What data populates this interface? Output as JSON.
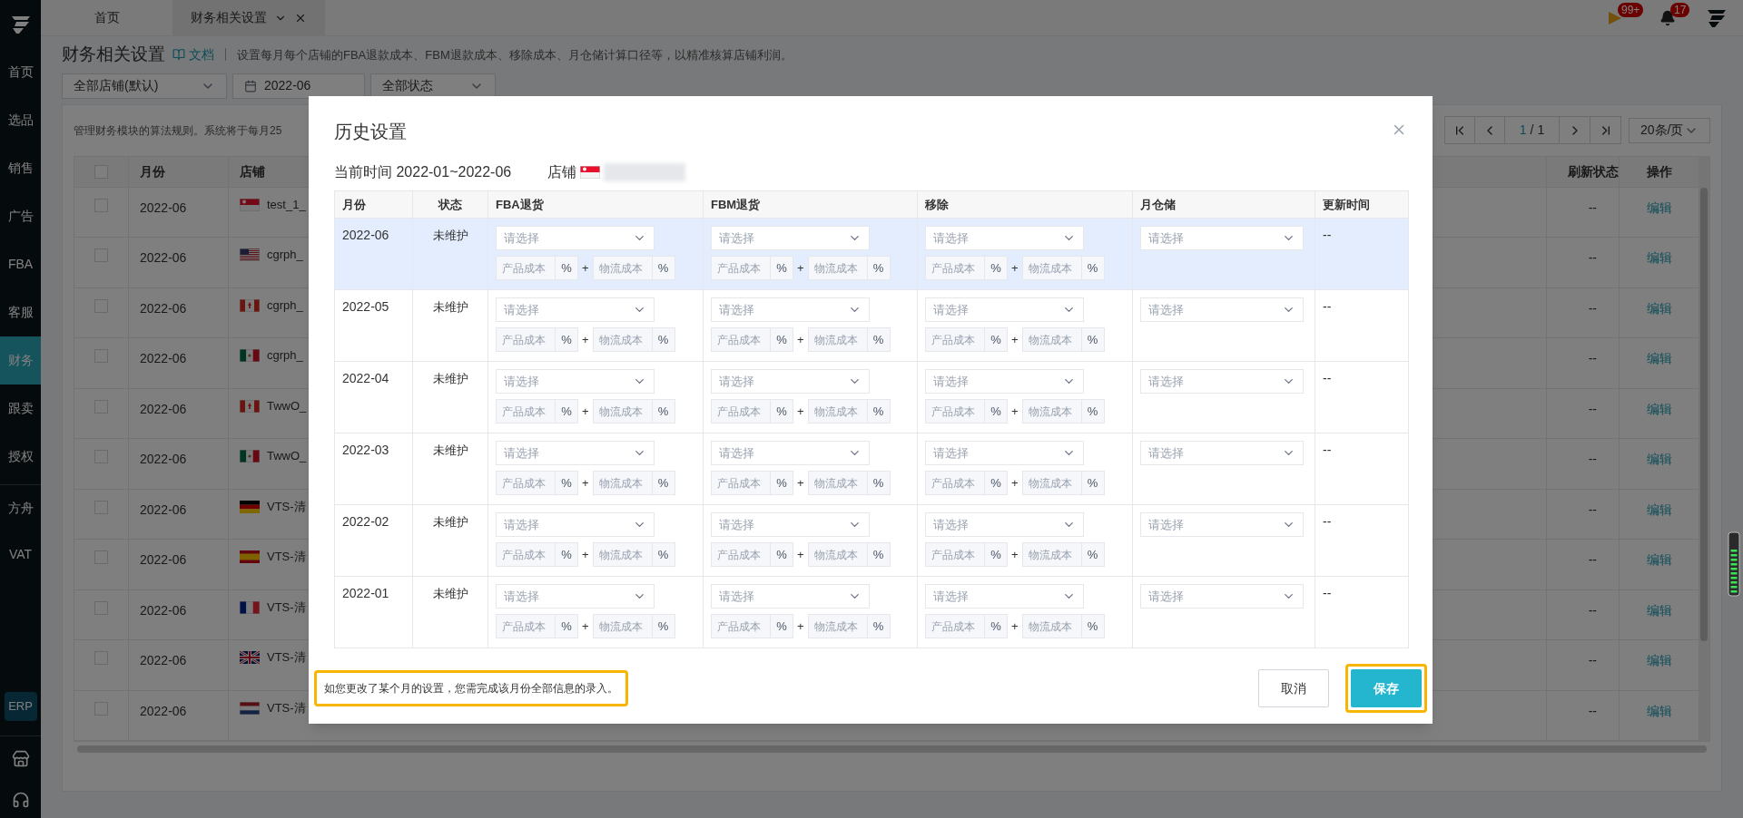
{
  "sidebar": {
    "items": [
      {
        "label": "首页",
        "selected": false
      },
      {
        "label": "选品",
        "selected": false
      },
      {
        "label": "销售",
        "selected": false
      },
      {
        "label": "广告",
        "selected": false
      },
      {
        "label": "FBA",
        "selected": false
      },
      {
        "label": "客服",
        "selected": false
      },
      {
        "label": "财务",
        "selected": true
      },
      {
        "label": "跟卖",
        "selected": false
      },
      {
        "label": "授权",
        "selected": false
      }
    ],
    "extra_items": [
      "方舟",
      "VAT"
    ],
    "erp": "ERP"
  },
  "tabs": [
    {
      "label": "首页",
      "selected": false,
      "closable": false
    },
    {
      "label": "财务相关设置",
      "selected": true,
      "closable": true
    }
  ],
  "header": {
    "flag_badge": "99+",
    "bell_badge": "17"
  },
  "page": {
    "title": "财务相关设置",
    "doc_link": "文档",
    "description": "设置每月每个店铺的FBA退款成本、FBM退款成本、移除成本、月仓储计算口径等，以精准核算店铺利润。"
  },
  "filters": {
    "store": "全部店铺(默认)",
    "date": "2022-06",
    "status": "全部状态"
  },
  "info": "管理财务模块的算法规则。系统将于每月25",
  "pagination": {
    "page": "1",
    "total": "/ 1",
    "page_size": "20条/页"
  },
  "table": {
    "columns": [
      "月份",
      "店铺",
      "刷新状态",
      "操作"
    ],
    "all_checked": false,
    "rows": [
      {
        "checked": false,
        "month": "2022-06",
        "flag": {
          "kind": "sg"
        },
        "store": "test_1_",
        "refresh": "--",
        "action": "编辑"
      },
      {
        "checked": false,
        "month": "2022-06",
        "flag": {
          "kind": "us"
        },
        "store": "cgrph_",
        "refresh": "--",
        "action": "编辑"
      },
      {
        "checked": false,
        "month": "2022-06",
        "flag": {
          "kind": "ca"
        },
        "store": "cgrph_",
        "refresh": "--",
        "action": "编辑"
      },
      {
        "checked": false,
        "month": "2022-06",
        "flag": {
          "kind": "mx"
        },
        "store": "cgrph_",
        "refresh": "--",
        "action": "编辑"
      },
      {
        "checked": false,
        "month": "2022-06",
        "flag": {
          "kind": "ca"
        },
        "store": "TwwO_",
        "refresh": "--",
        "action": "编辑"
      },
      {
        "checked": false,
        "month": "2022-06",
        "flag": {
          "kind": "mx"
        },
        "store": "TwwO_",
        "refresh": "--",
        "action": "编辑"
      },
      {
        "checked": false,
        "month": "2022-06",
        "flag": {
          "kind": "de"
        },
        "store": "VTS-清",
        "refresh": "--",
        "action": "编辑"
      },
      {
        "checked": false,
        "month": "2022-06",
        "flag": {
          "kind": "es"
        },
        "store": "VTS-清",
        "refresh": "--",
        "action": "编辑"
      },
      {
        "checked": false,
        "month": "2022-06",
        "flag": {
          "kind": "fr"
        },
        "store": "VTS-清",
        "refresh": "--",
        "action": "编辑"
      },
      {
        "checked": false,
        "month": "2022-06",
        "flag": {
          "kind": "gb"
        },
        "store": "VTS-清",
        "refresh": "--",
        "action": "编辑"
      },
      {
        "checked": false,
        "month": "2022-06",
        "flag": {
          "kind": "nl"
        },
        "store": "VTS-清",
        "refresh": "--",
        "action": "编辑"
      }
    ]
  },
  "modal": {
    "title": "历史设置",
    "period": "当前时间 2022-01~2022-06",
    "store_label": "店铺",
    "store_flag": {
      "kind": "sg"
    },
    "columns": [
      "月份",
      "状态",
      "FBA退货",
      "FBM退货",
      "移除",
      "月仓储",
      "更新时间"
    ],
    "rows": [
      {
        "month": "2022-06",
        "status": "未维护",
        "selected": true,
        "groups": [
          {
            "placeholder": "请选择",
            "product_placeholder": "产品成本",
            "unit": "%",
            "plus": "+",
            "logistics_placeholder": "物流成本",
            "unit_2": "%"
          },
          {
            "placeholder": "请选择",
            "product_placeholder": "产品成本",
            "unit": "%",
            "plus": "+",
            "logistics_placeholder": "物流成本",
            "unit_2": "%"
          },
          {
            "placeholder": "请选择",
            "product_placeholder": "产品成本",
            "unit": "%",
            "plus": "+",
            "logistics_placeholder": "物流成本",
            "unit_2": "%"
          }
        ],
        "storage_placeholder": "请选择",
        "updated": "--"
      },
      {
        "month": "2022-05",
        "status": "未维护",
        "selected": false,
        "groups": [
          {
            "placeholder": "请选择",
            "product_placeholder": "产品成本",
            "unit": "%",
            "plus": "+",
            "logistics_placeholder": "物流成本",
            "unit_2": "%"
          },
          {
            "placeholder": "请选择",
            "product_placeholder": "产品成本",
            "unit": "%",
            "plus": "+",
            "logistics_placeholder": "物流成本",
            "unit_2": "%"
          },
          {
            "placeholder": "请选择",
            "product_placeholder": "产品成本",
            "unit": "%",
            "plus": "+",
            "logistics_placeholder": "物流成本",
            "unit_2": "%"
          }
        ],
        "storage_placeholder": "请选择",
        "updated": "--"
      },
      {
        "month": "2022-04",
        "status": "未维护",
        "selected": false,
        "groups": [
          {
            "placeholder": "请选择",
            "product_placeholder": "产品成本",
            "unit": "%",
            "plus": "+",
            "logistics_placeholder": "物流成本",
            "unit_2": "%"
          },
          {
            "placeholder": "请选择",
            "product_placeholder": "产品成本",
            "unit": "%",
            "plus": "+",
            "logistics_placeholder": "物流成本",
            "unit_2": "%"
          },
          {
            "placeholder": "请选择",
            "product_placeholder": "产品成本",
            "unit": "%",
            "plus": "+",
            "logistics_placeholder": "物流成本",
            "unit_2": "%"
          }
        ],
        "storage_placeholder": "请选择",
        "updated": "--"
      },
      {
        "month": "2022-03",
        "status": "未维护",
        "selected": false,
        "groups": [
          {
            "placeholder": "请选择",
            "product_placeholder": "产品成本",
            "unit": "%",
            "plus": "+",
            "logistics_placeholder": "物流成本",
            "unit_2": "%"
          },
          {
            "placeholder": "请选择",
            "product_placeholder": "产品成本",
            "unit": "%",
            "plus": "+",
            "logistics_placeholder": "物流成本",
            "unit_2": "%"
          },
          {
            "placeholder": "请选择",
            "product_placeholder": "产品成本",
            "unit": "%",
            "plus": "+",
            "logistics_placeholder": "物流成本",
            "unit_2": "%"
          }
        ],
        "storage_placeholder": "请选择",
        "updated": "--"
      },
      {
        "month": "2022-02",
        "status": "未维护",
        "selected": false,
        "groups": [
          {
            "placeholder": "请选择",
            "product_placeholder": "产品成本",
            "unit": "%",
            "plus": "+",
            "logistics_placeholder": "物流成本",
            "unit_2": "%"
          },
          {
            "placeholder": "请选择",
            "product_placeholder": "产品成本",
            "unit": "%",
            "plus": "+",
            "logistics_placeholder": "物流成本",
            "unit_2": "%"
          },
          {
            "placeholder": "请选择",
            "product_placeholder": "产品成本",
            "unit": "%",
            "plus": "+",
            "logistics_placeholder": "物流成本",
            "unit_2": "%"
          }
        ],
        "storage_placeholder": "请选择",
        "updated": "--"
      },
      {
        "month": "2022-01",
        "status": "未维护",
        "selected": false,
        "groups": [
          {
            "placeholder": "请选择",
            "product_placeholder": "产品成本",
            "unit": "%",
            "plus": "+",
            "logistics_placeholder": "物流成本",
            "unit_2": "%"
          },
          {
            "placeholder": "请选择",
            "product_placeholder": "产品成本",
            "unit": "%",
            "plus": "+",
            "logistics_placeholder": "物流成本",
            "unit_2": "%"
          },
          {
            "placeholder": "请选择",
            "product_placeholder": "产品成本",
            "unit": "%",
            "plus": "+",
            "logistics_placeholder": "物流成本",
            "unit_2": "%"
          }
        ],
        "storage_placeholder": "请选择",
        "updated": "--"
      }
    ],
    "note": {
      "text": "如您更改了某个月的设置，您需完成该月份全部信息的录入。",
      "highlighted": true
    },
    "buttons": [
      {
        "label": "取消",
        "kind": "secondary",
        "highlighted": false
      },
      {
        "label": "保存",
        "kind": "primary",
        "highlighted": true
      }
    ]
  }
}
